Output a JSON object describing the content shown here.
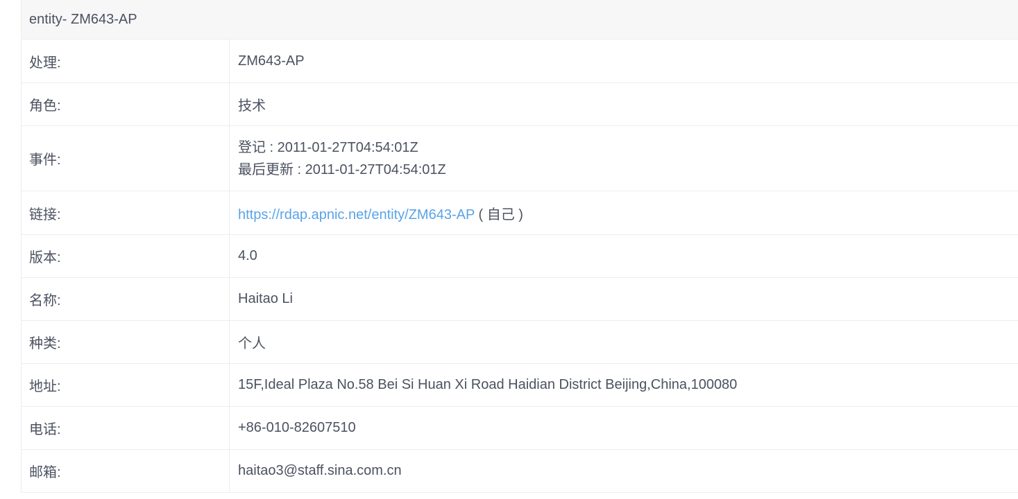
{
  "header": {
    "title": "entity- ZM643-AP"
  },
  "rows": {
    "handle": {
      "label": "处理:",
      "value": "ZM643-AP"
    },
    "roles": {
      "label": "角色:",
      "value": "技术"
    },
    "events": {
      "label": "事件:",
      "registration": "登记 : 2011-01-27T04:54:01Z",
      "last_changed": "最后更新 : 2011-01-27T04:54:01Z"
    },
    "links": {
      "label": "链接:",
      "url": "https://rdap.apnic.net/entity/ZM643-AP",
      "rel": "( 自己 )"
    },
    "version": {
      "label": "版本:",
      "value": "4.0"
    },
    "name": {
      "label": "名称:",
      "value": "Haitao Li"
    },
    "kind": {
      "label": "种类:",
      "value": "个人"
    },
    "address": {
      "label": "地址:",
      "value": "15F,Ideal Plaza No.58 Bei Si Huan Xi Road Haidian District Beijing,China,100080"
    },
    "phone": {
      "label": "电话:",
      "value": "+86-010-82607510"
    },
    "email": {
      "label": "邮箱:",
      "value": "haitao3@staff.sina.com.cn"
    }
  },
  "colors": {
    "text": "#4b5160",
    "link": "#5aa3e8",
    "header_bg": "#f7f7f8",
    "border": "#ebedf0"
  }
}
